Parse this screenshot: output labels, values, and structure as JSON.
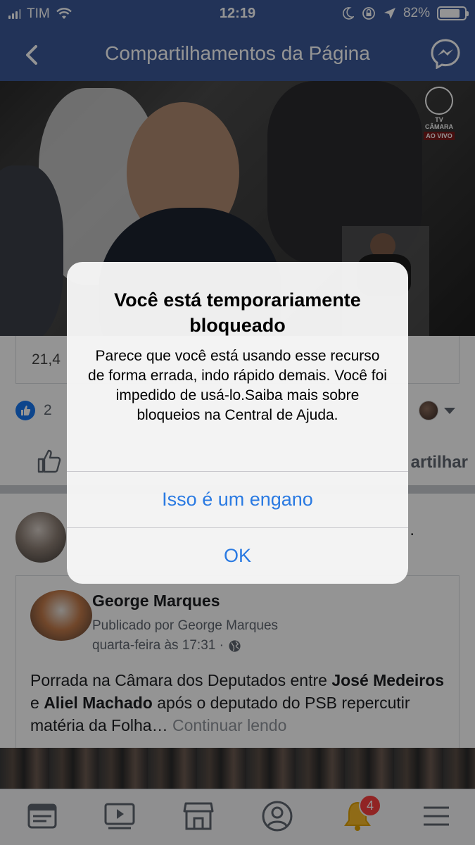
{
  "status_bar": {
    "carrier": "TIM",
    "time": "12:19",
    "battery_percent": "82%",
    "battery_level": 0.82,
    "icons": [
      "signal-icon",
      "wifi-icon",
      "moon-icon",
      "rotation-lock-icon",
      "location-icon",
      "battery-icon"
    ]
  },
  "navbar": {
    "title": "Compartilhamentos da Página",
    "back_icon": "chevron-left-icon",
    "right_icon": "messenger-icon"
  },
  "video": {
    "overlay_logo": "TV CÂMARA",
    "overlay_live": "AO VIVO"
  },
  "post": {
    "link_text": "21,4",
    "reaction_count": "2",
    "share_label": "artilhar"
  },
  "shared_post": {
    "author": "George Marques",
    "posted_by": "Publicado por George Marques",
    "time": "quarta-feira às 17:31 ·",
    "body_parts": {
      "t1": "Porrada na Câmara dos Deputados entre ",
      "b1": "José Medeiros",
      "t2": " e ",
      "b2": "Aliel Machado",
      "t3": " após o deputado do PSB repercutir matéria da Folha… ",
      "more": "Continuar lendo"
    },
    "trailing": "."
  },
  "tabbar": {
    "items": [
      "news-feed-icon",
      "watch-icon",
      "marketplace-icon",
      "profile-icon",
      "notifications-icon",
      "menu-icon"
    ],
    "notification_badge": "4"
  },
  "alert": {
    "title": "Você está temporariamente bloqueado",
    "message": "Parece que você está usando esse recurso de forma errada, indo rápido demais. Você foi impedido de usá-lo.Saiba mais sobre bloqueios na Central de Ajuda.",
    "button_primary": "Isso é um engano",
    "button_ok": "OK"
  },
  "colors": {
    "facebook_blue": "#3b5998",
    "ios_link_blue": "#2a7ae2",
    "badge_red": "#fa3e3e"
  }
}
